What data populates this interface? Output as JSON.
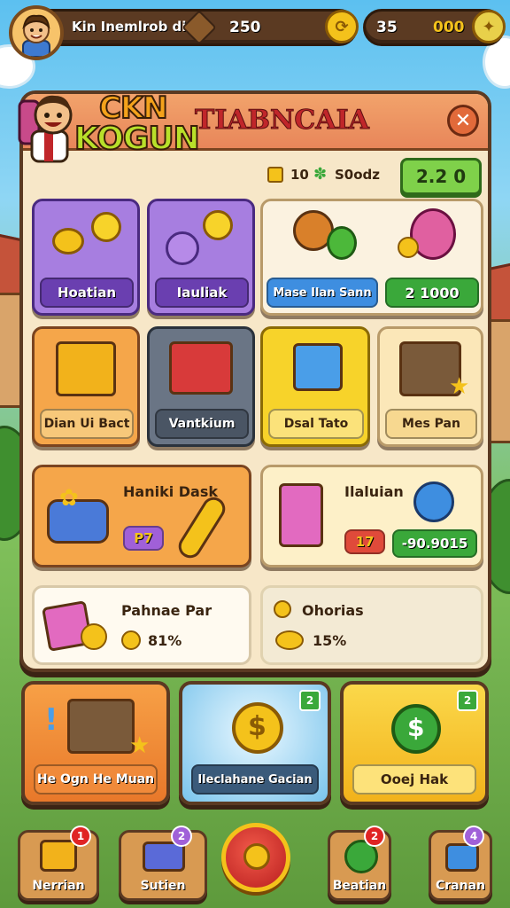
{
  "colors": {
    "accent": "#f4c21b",
    "panel": "#f7e7c8",
    "purple": "#8e5bcf",
    "blue": "#3e8ee0",
    "green": "#3aa83a"
  },
  "top": {
    "player_name": "Kin Inemlrob dis",
    "gold_value": "250",
    "gems_left": "35",
    "gems_right": "000"
  },
  "panel": {
    "logo_line1": "CKN",
    "logo_line2": "KOGUN",
    "title": "TIABNCAIA",
    "close_icon": "close-icon",
    "res_a": "10",
    "res_b": "S0odz",
    "res_total": "2.2 0"
  },
  "row1": [
    {
      "label": "Hoatian"
    },
    {
      "label": "Iauliak"
    },
    {
      "label": "Mase Ilan Sann",
      "price": "2 1000"
    }
  ],
  "row2": [
    {
      "label": "Dian Ui Bact"
    },
    {
      "label": "Vantkium"
    },
    {
      "label": "Dsal Tato"
    },
    {
      "label": "Mes Pan"
    }
  ],
  "row3": [
    {
      "title": "Haniki Dask",
      "tag": "P7"
    },
    {
      "title": "Ilaluian",
      "tag": "17",
      "price": "-90.9015"
    }
  ],
  "row4": [
    {
      "title": "Pahnae Par",
      "value": "81%"
    },
    {
      "title": "Ohorias",
      "value": "15%"
    }
  ],
  "offers": [
    {
      "label": "He Ogn He Muan"
    },
    {
      "label": "Ileclahane Gacian",
      "corner": "2"
    },
    {
      "label": "Ooej Hak",
      "corner": "2"
    }
  ],
  "nav": [
    {
      "label": "Nerrian",
      "badge": "1"
    },
    {
      "label": "Sutien",
      "badge": "2"
    },
    {
      "label": ""
    },
    {
      "label": "Beatian",
      "badge": "2"
    },
    {
      "label": "Cranan",
      "badge": "4"
    }
  ]
}
